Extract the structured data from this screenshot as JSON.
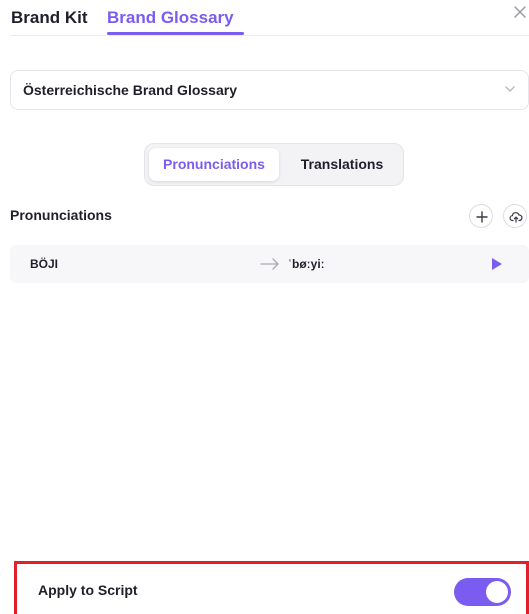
{
  "header": {
    "tabs": [
      {
        "label": "Brand Kit",
        "active": false
      },
      {
        "label": "Brand Glossary",
        "active": true
      }
    ],
    "close_icon": "close-icon"
  },
  "glossary_select": {
    "value": "Österreichische Brand Glossary",
    "icon": "chevron-down-icon"
  },
  "segmented": {
    "options": [
      "Pronunciations",
      "Translations"
    ],
    "selected": "Pronunciations"
  },
  "section": {
    "title": "Pronunciations",
    "add_icon": "plus-icon",
    "upload_icon": "cloud-upload-icon"
  },
  "entries": [
    {
      "word": "BÖJI",
      "pronunciation": "ˈbøːyiː"
    }
  ],
  "footer": {
    "label": "Apply to Script",
    "toggle_on": true
  },
  "colors": {
    "accent": "#7b5cf0",
    "highlight_border": "#e2202b",
    "text": "#1f1f2b"
  }
}
